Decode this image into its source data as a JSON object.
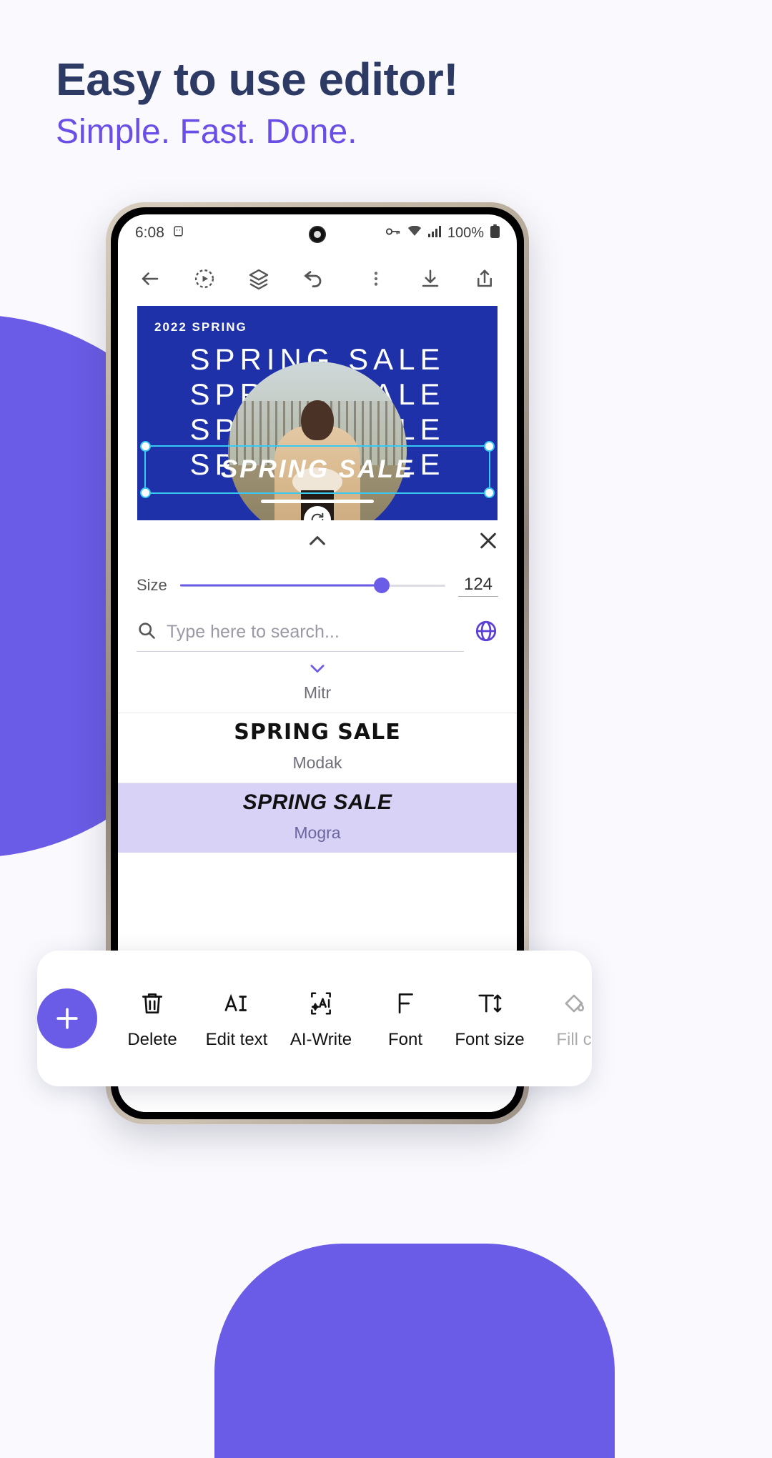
{
  "promo": {
    "headline": "Easy to use editor!",
    "subhead": "Simple. Fast. Done.",
    "headline_color": "#2C3A64",
    "subhead_color": "#6B4EE6",
    "accent_color": "#6B5CE7"
  },
  "statusbar": {
    "time": "6:08",
    "rotate_icon": "screen-rotation-icon",
    "camera_icon": "front-camera-punchhole",
    "vpn_icon": "vpn-key-icon",
    "wifi_icon": "wifi-icon",
    "signal_icon": "cellular-signal-icon",
    "battery_percent": "100%",
    "battery_icon": "battery-full-icon"
  },
  "toolbar": {
    "back": "back-arrow-icon",
    "preview": "play-circle-icon",
    "layers": "layers-icon",
    "undo": "undo-icon",
    "more": "more-vertical-icon",
    "download": "download-icon",
    "share": "share-icon"
  },
  "canvas": {
    "year_label": "2022 SPRING",
    "rows": [
      "SPRING SALE",
      "SPRING SALE",
      "SPRING SALE",
      "SPRING SALE"
    ],
    "selected_text": "SPRING SALE",
    "rotate_icon": "rotate-icon",
    "background_color": "#1F31A8",
    "selection_color": "#38C8F0"
  },
  "panel": {
    "collapse_icon": "chevron-up-icon",
    "close_icon": "close-icon",
    "size_label": "Size",
    "size_value": "124",
    "slider_percent": 76,
    "search_placeholder": "Type here to search...",
    "search_value": "",
    "search_icon": "search-icon",
    "language_icon": "globe-icon",
    "expand_icon": "chevron-down-icon",
    "fonts": [
      {
        "sample": "SPRING SALE",
        "name": "Mitr",
        "selected": false
      },
      {
        "sample": "SPRING SALE",
        "name": "Modak",
        "selected": false
      },
      {
        "sample": "SPRING SALE",
        "name": "Mogra",
        "selected": true
      }
    ]
  },
  "bottombar": {
    "add_label": "+",
    "add_icon": "plus-icon",
    "items": [
      {
        "label": "Delete",
        "icon": "trash-icon"
      },
      {
        "label": "Edit text",
        "icon": "edit-text-icon"
      },
      {
        "label": "AI-Write",
        "icon": "ai-write-icon"
      },
      {
        "label": "Font",
        "icon": "font-icon"
      },
      {
        "label": "Font size",
        "icon": "font-size-icon"
      },
      {
        "label": "Fill c",
        "icon": "fill-color-icon"
      }
    ],
    "next_icon": "chevron-right-icon"
  }
}
